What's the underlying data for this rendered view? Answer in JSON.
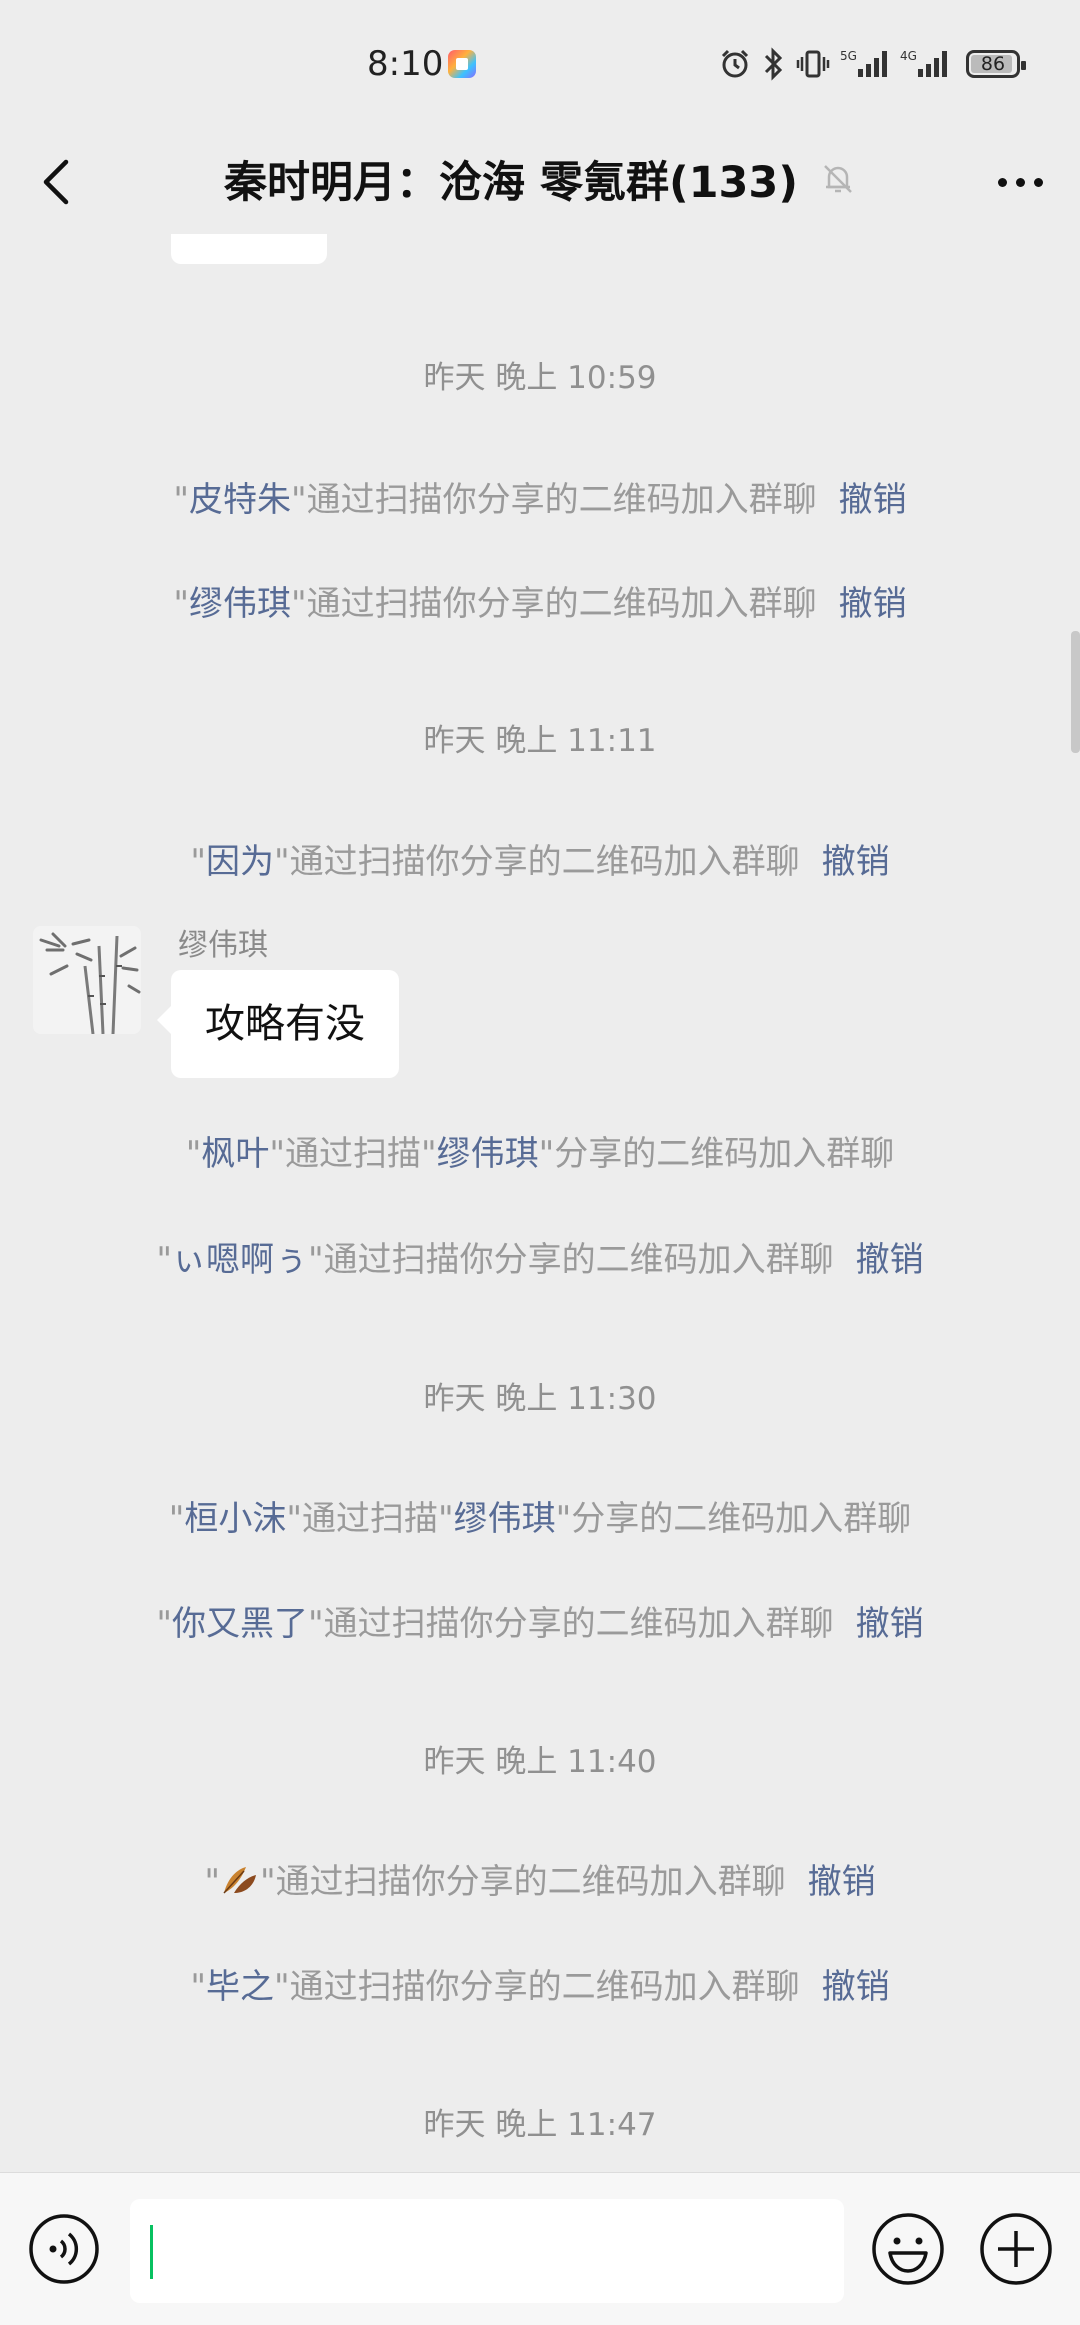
{
  "status_bar": {
    "time": "8:10",
    "network_5g": "5G",
    "network_4g": "4G",
    "battery": "86"
  },
  "nav": {
    "title": "秦时明月：沧海 零氪群(133)"
  },
  "chat": {
    "partial_bubble_text": "\"\"",
    "timestamps": [
      "昨天 晚上 10:59",
      "昨天 晚上 11:11",
      "昨天 晚上 11:30",
      "昨天 晚上 11:40",
      "昨天 晚上 11:47"
    ],
    "join_text": "\"通过扫描你分享的二维码加入群聊",
    "join_text_via_pre": "\"通过扫描\"",
    "join_text_via_post": "\"分享的二维码加入群聊",
    "revoke": "撤销",
    "quote": "\"",
    "names": [
      "皮特朱",
      "缪伟琪",
      "因为",
      "枫叶",
      "ぃ嗯啊ぅ",
      "桓小沫",
      "你又黑了",
      "毕之"
    ],
    "inviter": "缪伟琪",
    "message": {
      "sender": "缪伟琪",
      "text": "攻略有没"
    }
  },
  "input": {
    "placeholder": ""
  },
  "colors": {
    "background": "#ededed",
    "link": "#576b95",
    "system_text": "#9a9a9a",
    "caret": "#07c160"
  }
}
